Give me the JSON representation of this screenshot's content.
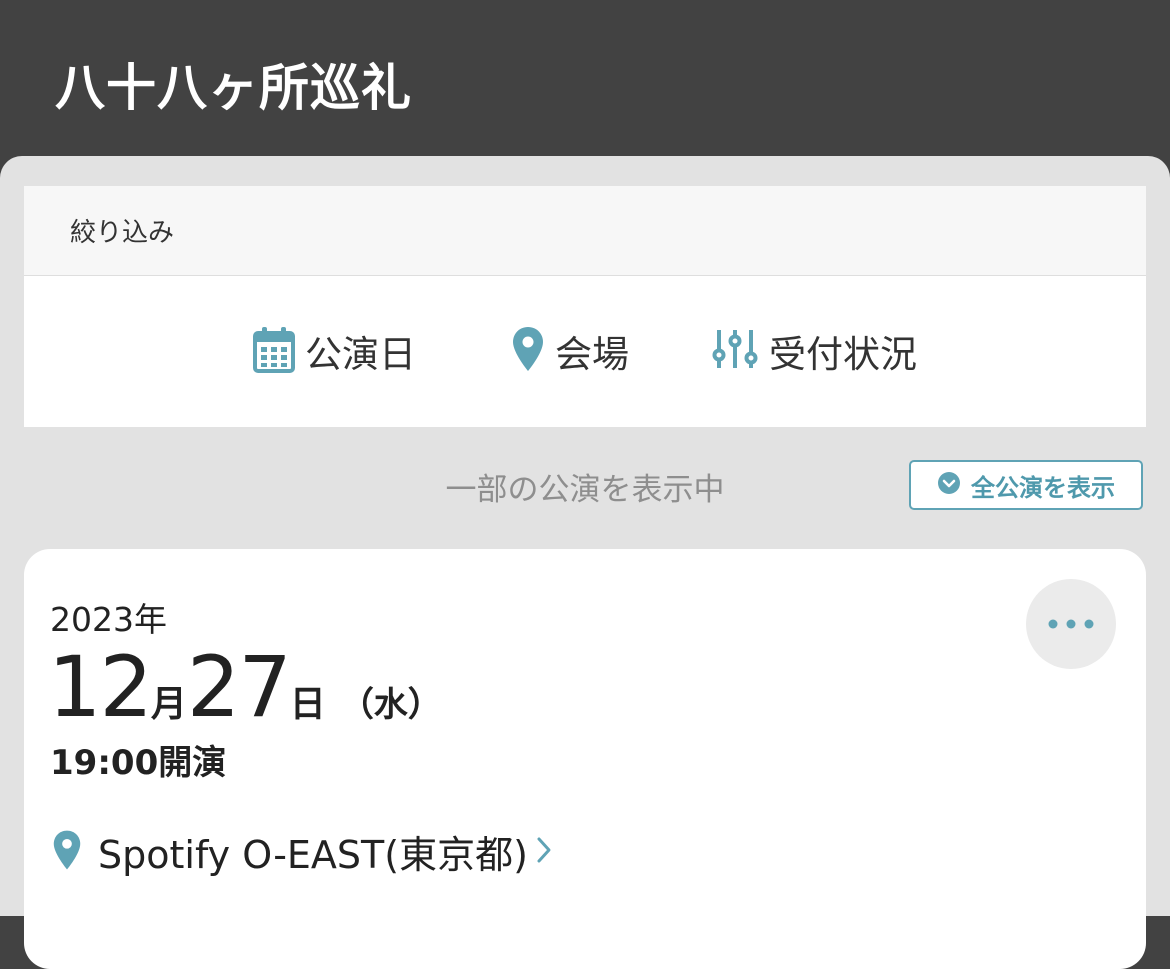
{
  "header": {
    "title": "八十八ヶ所巡礼"
  },
  "filter": {
    "heading": "絞り込み",
    "options": [
      {
        "label": "公演日",
        "icon": "calendar-icon"
      },
      {
        "label": "会場",
        "icon": "map-pin-icon"
      },
      {
        "label": "受付状況",
        "icon": "sliders-icon"
      }
    ]
  },
  "listing": {
    "status_text": "一部の公演を表示中",
    "show_all_label": "全公演を表示",
    "show_all_icon": "chevron-circle-down-icon"
  },
  "performance": {
    "year": "2023年",
    "month": "12",
    "month_unit": "月",
    "day": "27",
    "day_unit": "日",
    "weekday": "（水）",
    "time": "19:00開演",
    "venue": "Spotify O-EAST(東京都)",
    "more_icon": "more-horizontal-icon"
  },
  "colors": {
    "header_bg": "#424242",
    "accent": "#5fa3b5",
    "sheet_bg": "#e2e2e2"
  }
}
